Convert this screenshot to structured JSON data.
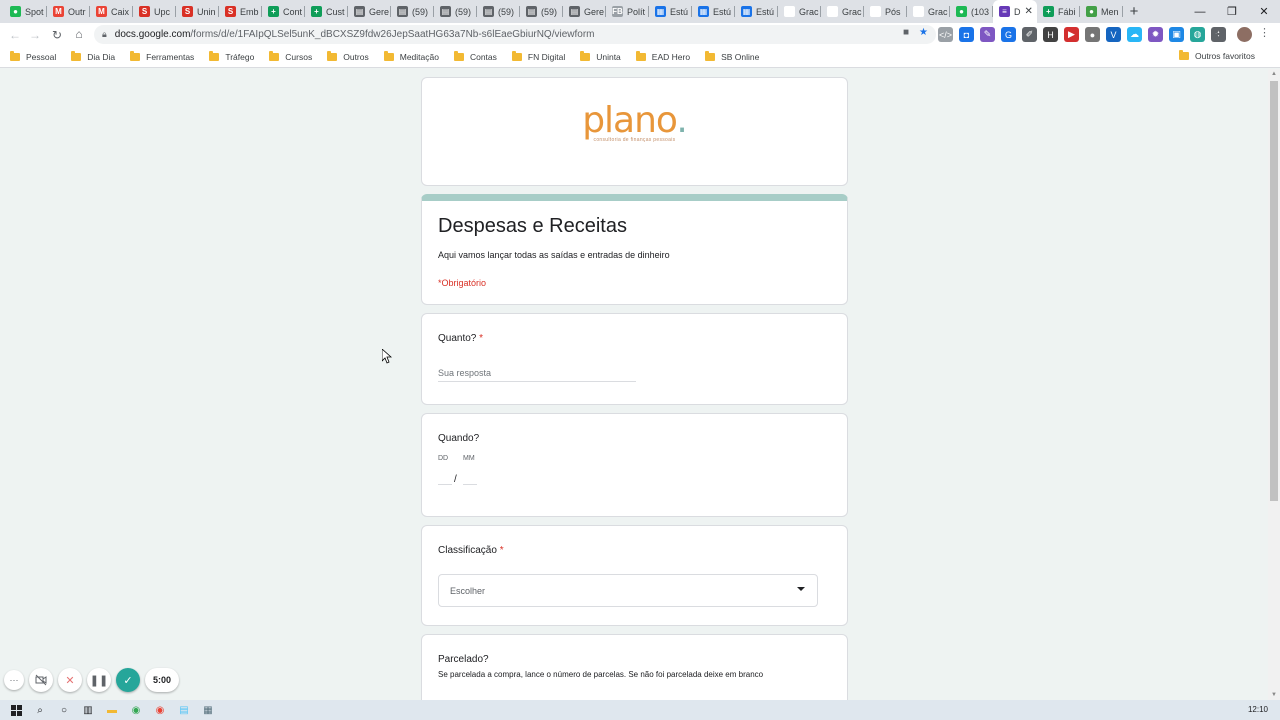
{
  "browser": {
    "tabs": [
      {
        "label": "Spot",
        "fav_color": "#1db954",
        "fav_glyph": "●"
      },
      {
        "label": "Outr",
        "fav_color": "#ea4335",
        "fav_glyph": "M"
      },
      {
        "label": "Caix",
        "fav_color": "#ea4335",
        "fav_glyph": "M"
      },
      {
        "label": "Upc",
        "fav_color": "#d93025",
        "fav_glyph": "S"
      },
      {
        "label": "Unin",
        "fav_color": "#d93025",
        "fav_glyph": "S"
      },
      {
        "label": "Emb",
        "fav_color": "#d93025",
        "fav_glyph": "S"
      },
      {
        "label": "Cont",
        "fav_color": "#0f9d58",
        "fav_glyph": "+"
      },
      {
        "label": "Cust",
        "fav_color": "#0f9d58",
        "fav_glyph": "+"
      },
      {
        "label": "Gere",
        "fav_color": "#5f6368",
        "fav_glyph": "▤"
      },
      {
        "label": "(59)",
        "fav_color": "#5f6368",
        "fav_glyph": "▤"
      },
      {
        "label": "(59)",
        "fav_color": "#5f6368",
        "fav_glyph": "▤"
      },
      {
        "label": "(59)",
        "fav_color": "#5f6368",
        "fav_glyph": "▤"
      },
      {
        "label": "(59)",
        "fav_color": "#5f6368",
        "fav_glyph": "▤"
      },
      {
        "label": "Gere",
        "fav_color": "#5f6368",
        "fav_glyph": "▤"
      },
      {
        "label": "Polít",
        "fav_color": "#9aa0a6",
        "fav_glyph": "FB"
      },
      {
        "label": "Estú",
        "fav_color": "#1a73e8",
        "fav_glyph": "▦"
      },
      {
        "label": "Estú",
        "fav_color": "#1a73e8",
        "fav_glyph": "▦"
      },
      {
        "label": "Estú",
        "fav_color": "#1a73e8",
        "fav_glyph": "▦"
      },
      {
        "label": "Grac",
        "fav_color": "#ffffff",
        "fav_glyph": ""
      },
      {
        "label": "Grac",
        "fav_color": "#ffffff",
        "fav_glyph": ""
      },
      {
        "label": "Pós",
        "fav_color": "#ffffff",
        "fav_glyph": ""
      },
      {
        "label": "Grac",
        "fav_color": "#ffffff",
        "fav_glyph": ""
      },
      {
        "label": "(103",
        "fav_color": "#1db954",
        "fav_glyph": "●"
      },
      {
        "label": "D",
        "fav_color": "#673ab7",
        "fav_glyph": "≡",
        "active": true
      },
      {
        "label": "Fábi",
        "fav_color": "#0f9d58",
        "fav_glyph": "+"
      },
      {
        "label": "Men",
        "fav_color": "#43a047",
        "fav_glyph": "●"
      }
    ],
    "new_tab_glyph": "+",
    "window_controls": [
      "—",
      "❐",
      "✕"
    ],
    "url_host": "docs.google.com",
    "url_path": "/forms/d/e/1FAIpQLSel5unK_dBCXSZ9fdw26JepSaatHG63a7Nb-s6lEaeGbiurNQ/viewform",
    "bookmarks": [
      "Pessoal",
      "Dia Dia",
      "Ferramentas",
      "Tráfego",
      "Cursos",
      "Outros",
      "Meditação",
      "Contas",
      "FN Digital",
      "Uninta",
      "EAD Hero",
      "SB Online"
    ],
    "other_bookmarks": "Outros favoritos",
    "extensions": [
      {
        "color": "#9aa0a6",
        "glyph": "</>"
      },
      {
        "color": "#1a73e8",
        "glyph": "◘"
      },
      {
        "color": "#7e57c2",
        "glyph": "✎"
      },
      {
        "color": "#1a73e8",
        "glyph": "G"
      },
      {
        "color": "#5f6368",
        "glyph": "✐"
      },
      {
        "color": "#424242",
        "glyph": "H"
      },
      {
        "color": "#d32f2f",
        "glyph": "▶"
      },
      {
        "color": "#757575",
        "glyph": "●"
      },
      {
        "color": "#1565c0",
        "glyph": "V"
      },
      {
        "color": "#29b6f6",
        "glyph": "☁"
      },
      {
        "color": "#7e57c2",
        "glyph": "✹"
      },
      {
        "color": "#1e88e5",
        "glyph": "▣"
      },
      {
        "color": "#26a69a",
        "glyph": "◍"
      },
      {
        "color": "#5f6368",
        "glyph": "✦"
      }
    ]
  },
  "form": {
    "logo_word": "plano",
    "logo_dot": ".",
    "logo_sub": "consultoria de finanças pessoais",
    "title": "Despesas e Receitas",
    "description": "Aqui vamos lançar todas as saídas e entradas de dinheiro",
    "required_note": "*Obrigatório",
    "accent_color": "#a7cdc7",
    "questions": {
      "quanto": {
        "title": "Quanto?",
        "required_mark": "*",
        "placeholder": "Sua resposta"
      },
      "quando": {
        "title": "Quando?",
        "day_label": "DD",
        "month_label": "MM",
        "separator": "/"
      },
      "classificacao": {
        "title": "Classificação",
        "required_mark": "*",
        "placeholder": "Escolher"
      },
      "parcelado": {
        "title": "Parcelado?",
        "help": "Se parcelada a compra, lance o número de parcelas. Se não foi parcelada deixe em branco"
      }
    }
  },
  "recorder": {
    "timer": "5:00",
    "more_glyph": "···",
    "close_glyph": "✕",
    "pause_glyph": "❚❚",
    "done_glyph": "✓"
  },
  "taskbar": {
    "clock": "12:10"
  }
}
